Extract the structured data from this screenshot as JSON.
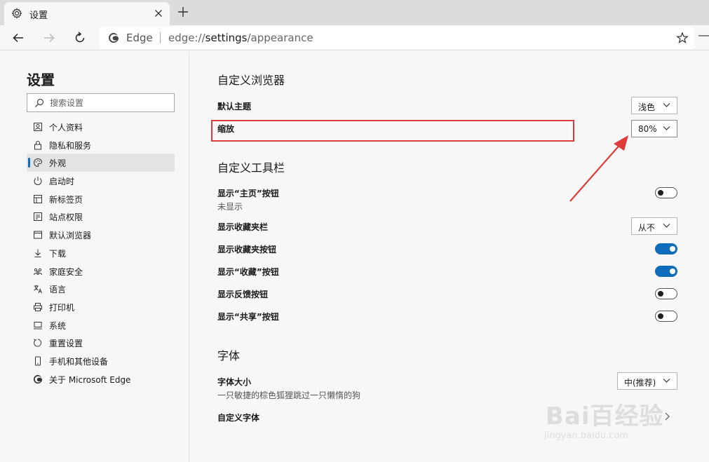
{
  "tab": {
    "title": "设置"
  },
  "address": {
    "site": "Edge",
    "url_prefix": "edge://",
    "url_path": "settings",
    "url_suffix": "/appearance"
  },
  "sidebar": {
    "title": "设置",
    "search_placeholder": "搜索设置",
    "items": [
      {
        "label": "个人资料",
        "icon": "profile-icon"
      },
      {
        "label": "隐私和服务",
        "icon": "lock-icon"
      },
      {
        "label": "外观",
        "icon": "palette-icon",
        "active": true
      },
      {
        "label": "启动时",
        "icon": "power-icon"
      },
      {
        "label": "新标签页",
        "icon": "grid-icon"
      },
      {
        "label": "站点权限",
        "icon": "site-permissions-icon"
      },
      {
        "label": "默认浏览器",
        "icon": "browser-icon"
      },
      {
        "label": "下载",
        "icon": "download-icon"
      },
      {
        "label": "家庭安全",
        "icon": "family-icon"
      },
      {
        "label": "语言",
        "icon": "language-icon"
      },
      {
        "label": "打印机",
        "icon": "printer-icon"
      },
      {
        "label": "系统",
        "icon": "system-icon"
      },
      {
        "label": "重置设置",
        "icon": "reset-icon"
      },
      {
        "label": "手机和其他设备",
        "icon": "phone-icon"
      },
      {
        "label": "关于 Microsoft Edge",
        "icon": "edge-logo-icon"
      }
    ]
  },
  "main": {
    "customize_browser": {
      "title": "自定义浏览器",
      "theme_label": "默认主题",
      "theme_value": "浅色",
      "zoom_label": "缩放",
      "zoom_value": "80%"
    },
    "customize_toolbar": {
      "title": "自定义工具栏",
      "home_label": "显示“主页”按钮",
      "home_sub": "未显示",
      "home_on": false,
      "favbar_label": "显示收藏夹栏",
      "favbar_value": "从不",
      "favbtn_label": "显示收藏夹按钮",
      "favbtn_on": true,
      "collections_label": "显示“收藏”按钮",
      "collections_on": true,
      "feedback_label": "显示反馈按钮",
      "feedback_on": false,
      "share_label": "显示“共享”按钮",
      "share_on": false
    },
    "fonts": {
      "title": "字体",
      "size_label": "字体大小",
      "size_sample": "一只敏捷的棕色狐狸跳过一只懒惰的狗",
      "size_value": "中(推荐)",
      "custom_label": "自定义字体"
    }
  },
  "watermark": {
    "main": "Bai百经验",
    "sub": "jingyan.baidu.com"
  },
  "colors": {
    "accent": "#0f6cbd",
    "annotation": "#e03b3b"
  }
}
